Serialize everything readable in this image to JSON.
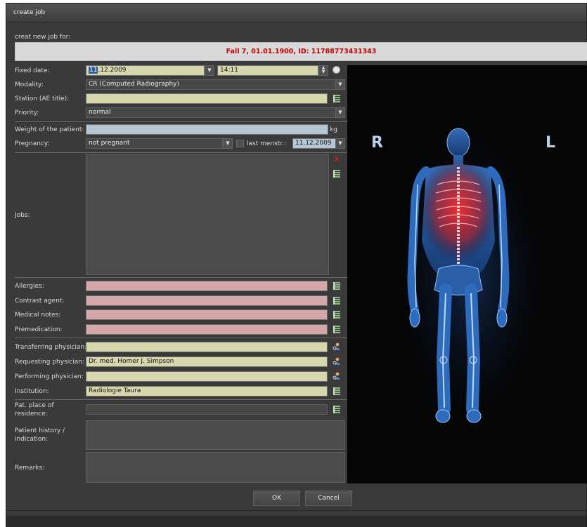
{
  "window": {
    "title": "create job"
  },
  "header": {
    "subtitle": "creat new job for:",
    "patient_line": "Fall 7, 01.01.1900, ID: 11788773431343"
  },
  "form": {
    "fixed_date": {
      "label": "Fixed date:",
      "date_sel": "11",
      "date_rest": ".12.2009",
      "time": "14:11"
    },
    "modality": {
      "label": "Modality:",
      "value": "CR (Computed Radiography)"
    },
    "station": {
      "label": "Station (AE title):",
      "value": ""
    },
    "priority": {
      "label": "Priority:",
      "value": "normal"
    },
    "weight": {
      "label": "Weight of the patient:",
      "value": "",
      "unit": "kg"
    },
    "pregnancy": {
      "label": "Pregnancy:",
      "value": "not pregnant",
      "last_menstr_label": "last menstr.:",
      "last_menstr_date": "11.12.2009"
    },
    "jobs": {
      "label": "Jobs:"
    },
    "allergies": {
      "label": "Allergies:",
      "value": ""
    },
    "contrast": {
      "label": "Contrast agent:",
      "value": ""
    },
    "medical_notes": {
      "label": "Medical notes:",
      "value": ""
    },
    "premedication": {
      "label": "Premedication:",
      "value": ""
    },
    "transferring": {
      "label": "Transferring physician:",
      "value": ""
    },
    "requesting": {
      "label": "Requesting physician:",
      "value": "Dr. med. Homer J. Simpson"
    },
    "performing": {
      "label": "Performing physician:",
      "value": ""
    },
    "institution": {
      "label": "Institution:",
      "value": "Radiologie Taura"
    },
    "residence": {
      "label": "Pat. place of residence:",
      "value": ""
    },
    "history": {
      "label": "Patient history / indication:",
      "value": ""
    },
    "remarks": {
      "label": "Remarks:",
      "value": ""
    }
  },
  "body_image": {
    "left_marker": "R",
    "right_marker": "L"
  },
  "buttons": {
    "ok": "OK",
    "cancel": "Cancel"
  },
  "colors": {
    "mandatory_field": "#d9d7ad",
    "warning_field": "#d4a8a8",
    "info_field": "#b5c7d4",
    "patient_text": "#c00000"
  }
}
